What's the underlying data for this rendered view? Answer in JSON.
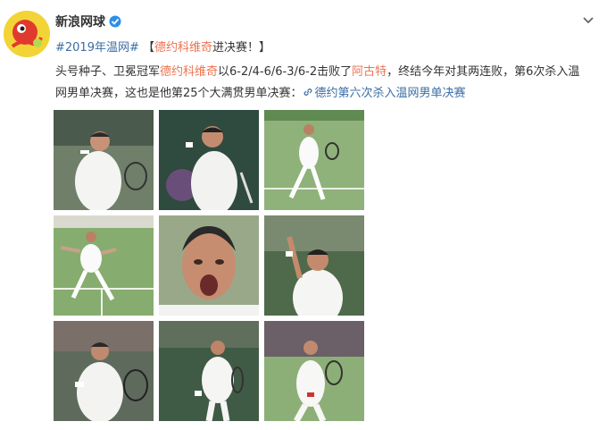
{
  "account": {
    "name": "新浪网球",
    "avatar_icon": "sina-tennis-logo-icon",
    "verified_icon": "verified-badge-icon"
  },
  "post": {
    "topic": "#2019年温网#",
    "headline_prefix": "【",
    "headline_link": "德约科维奇",
    "headline_suffix": "进决赛！】",
    "text_1": "头号种子、卫冕冠军",
    "text_link1": "德约科维奇",
    "text_2": "以6-2/4-6/6-3/6-2击败了",
    "text_link2": "阿古特",
    "text_3": "，终结今年对其两连败，第6次杀入温网男单决赛，这也是他第25个大满贯男单决赛：",
    "article_link": "德约第六次杀入温网男单决赛"
  },
  "colors": {
    "accent_orange": "#eb7350",
    "link_blue": "#3a6ea5",
    "grass": "#7aa35a"
  },
  "photos": [
    {
      "name": "photo-1"
    },
    {
      "name": "photo-2"
    },
    {
      "name": "photo-3"
    },
    {
      "name": "photo-4"
    },
    {
      "name": "photo-5"
    },
    {
      "name": "photo-6"
    },
    {
      "name": "photo-7"
    },
    {
      "name": "photo-8"
    },
    {
      "name": "photo-9"
    }
  ]
}
